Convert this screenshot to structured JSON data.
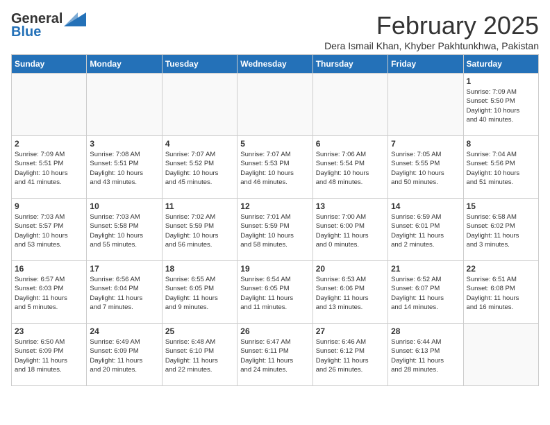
{
  "header": {
    "logo_general": "General",
    "logo_blue": "Blue",
    "month_title": "February 2025",
    "subtitle": "Dera Ismail Khan, Khyber Pakhtunkhwa, Pakistan"
  },
  "weekdays": [
    "Sunday",
    "Monday",
    "Tuesday",
    "Wednesday",
    "Thursday",
    "Friday",
    "Saturday"
  ],
  "weeks": [
    [
      {
        "day": "",
        "info": ""
      },
      {
        "day": "",
        "info": ""
      },
      {
        "day": "",
        "info": ""
      },
      {
        "day": "",
        "info": ""
      },
      {
        "day": "",
        "info": ""
      },
      {
        "day": "",
        "info": ""
      },
      {
        "day": "1",
        "info": "Sunrise: 7:09 AM\nSunset: 5:50 PM\nDaylight: 10 hours\nand 40 minutes."
      }
    ],
    [
      {
        "day": "2",
        "info": "Sunrise: 7:09 AM\nSunset: 5:51 PM\nDaylight: 10 hours\nand 41 minutes."
      },
      {
        "day": "3",
        "info": "Sunrise: 7:08 AM\nSunset: 5:51 PM\nDaylight: 10 hours\nand 43 minutes."
      },
      {
        "day": "4",
        "info": "Sunrise: 7:07 AM\nSunset: 5:52 PM\nDaylight: 10 hours\nand 45 minutes."
      },
      {
        "day": "5",
        "info": "Sunrise: 7:07 AM\nSunset: 5:53 PM\nDaylight: 10 hours\nand 46 minutes."
      },
      {
        "day": "6",
        "info": "Sunrise: 7:06 AM\nSunset: 5:54 PM\nDaylight: 10 hours\nand 48 minutes."
      },
      {
        "day": "7",
        "info": "Sunrise: 7:05 AM\nSunset: 5:55 PM\nDaylight: 10 hours\nand 50 minutes."
      },
      {
        "day": "8",
        "info": "Sunrise: 7:04 AM\nSunset: 5:56 PM\nDaylight: 10 hours\nand 51 minutes."
      }
    ],
    [
      {
        "day": "9",
        "info": "Sunrise: 7:03 AM\nSunset: 5:57 PM\nDaylight: 10 hours\nand 53 minutes."
      },
      {
        "day": "10",
        "info": "Sunrise: 7:03 AM\nSunset: 5:58 PM\nDaylight: 10 hours\nand 55 minutes."
      },
      {
        "day": "11",
        "info": "Sunrise: 7:02 AM\nSunset: 5:59 PM\nDaylight: 10 hours\nand 56 minutes."
      },
      {
        "day": "12",
        "info": "Sunrise: 7:01 AM\nSunset: 5:59 PM\nDaylight: 10 hours\nand 58 minutes."
      },
      {
        "day": "13",
        "info": "Sunrise: 7:00 AM\nSunset: 6:00 PM\nDaylight: 11 hours\nand 0 minutes."
      },
      {
        "day": "14",
        "info": "Sunrise: 6:59 AM\nSunset: 6:01 PM\nDaylight: 11 hours\nand 2 minutes."
      },
      {
        "day": "15",
        "info": "Sunrise: 6:58 AM\nSunset: 6:02 PM\nDaylight: 11 hours\nand 3 minutes."
      }
    ],
    [
      {
        "day": "16",
        "info": "Sunrise: 6:57 AM\nSunset: 6:03 PM\nDaylight: 11 hours\nand 5 minutes."
      },
      {
        "day": "17",
        "info": "Sunrise: 6:56 AM\nSunset: 6:04 PM\nDaylight: 11 hours\nand 7 minutes."
      },
      {
        "day": "18",
        "info": "Sunrise: 6:55 AM\nSunset: 6:05 PM\nDaylight: 11 hours\nand 9 minutes."
      },
      {
        "day": "19",
        "info": "Sunrise: 6:54 AM\nSunset: 6:05 PM\nDaylight: 11 hours\nand 11 minutes."
      },
      {
        "day": "20",
        "info": "Sunrise: 6:53 AM\nSunset: 6:06 PM\nDaylight: 11 hours\nand 13 minutes."
      },
      {
        "day": "21",
        "info": "Sunrise: 6:52 AM\nSunset: 6:07 PM\nDaylight: 11 hours\nand 14 minutes."
      },
      {
        "day": "22",
        "info": "Sunrise: 6:51 AM\nSunset: 6:08 PM\nDaylight: 11 hours\nand 16 minutes."
      }
    ],
    [
      {
        "day": "23",
        "info": "Sunrise: 6:50 AM\nSunset: 6:09 PM\nDaylight: 11 hours\nand 18 minutes."
      },
      {
        "day": "24",
        "info": "Sunrise: 6:49 AM\nSunset: 6:09 PM\nDaylight: 11 hours\nand 20 minutes."
      },
      {
        "day": "25",
        "info": "Sunrise: 6:48 AM\nSunset: 6:10 PM\nDaylight: 11 hours\nand 22 minutes."
      },
      {
        "day": "26",
        "info": "Sunrise: 6:47 AM\nSunset: 6:11 PM\nDaylight: 11 hours\nand 24 minutes."
      },
      {
        "day": "27",
        "info": "Sunrise: 6:46 AM\nSunset: 6:12 PM\nDaylight: 11 hours\nand 26 minutes."
      },
      {
        "day": "28",
        "info": "Sunrise: 6:44 AM\nSunset: 6:13 PM\nDaylight: 11 hours\nand 28 minutes."
      },
      {
        "day": "",
        "info": ""
      }
    ]
  ]
}
